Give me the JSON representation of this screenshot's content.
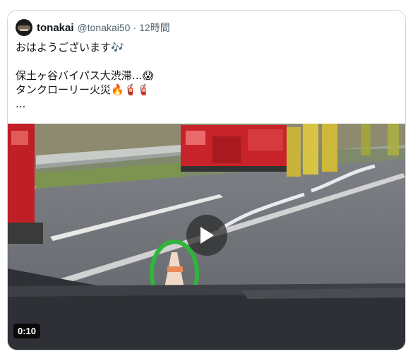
{
  "post": {
    "author_name": "tonakai",
    "author_handle": "@tonakai50",
    "separator": "·",
    "time": "12時間",
    "avatar_icon": "user-avatar",
    "lines": [
      "おはようございます🎶",
      "",
      "保土ヶ谷バイパス大渋滞…😱",
      "タンクローリー火災🔥🧯🧯",
      "..."
    ]
  },
  "media": {
    "type": "video",
    "duration": "0:10",
    "play_icon": "play-icon",
    "highlight_color": "#2fb53c"
  }
}
